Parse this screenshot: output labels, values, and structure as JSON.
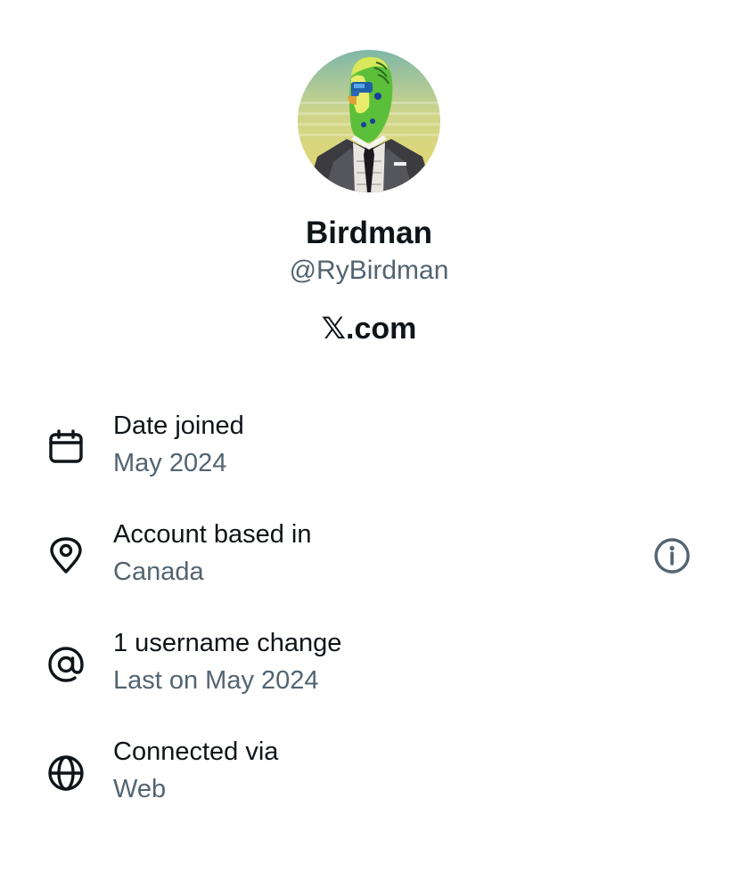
{
  "profile": {
    "display_name": "Birdman",
    "handle": "@RyBirdman",
    "site_logo": "𝕏",
    "site_tld": ".com",
    "avatar_icon": "avatar-pixel-budgie-in-suit"
  },
  "details": [
    {
      "icon": "calendar-icon",
      "title": "Date joined",
      "subtitle": "May 2024"
    },
    {
      "icon": "location-pin-icon",
      "title": "Account based in",
      "subtitle": "Canada",
      "action_icon": "info-icon"
    },
    {
      "icon": "at-sign-icon",
      "title": "1 username change",
      "subtitle": "Last on May 2024"
    },
    {
      "icon": "globe-icon",
      "title": "Connected via",
      "subtitle": "Web"
    }
  ],
  "colors": {
    "primary_text": "#0f1419",
    "secondary_text": "#536471",
    "background": "#ffffff"
  }
}
